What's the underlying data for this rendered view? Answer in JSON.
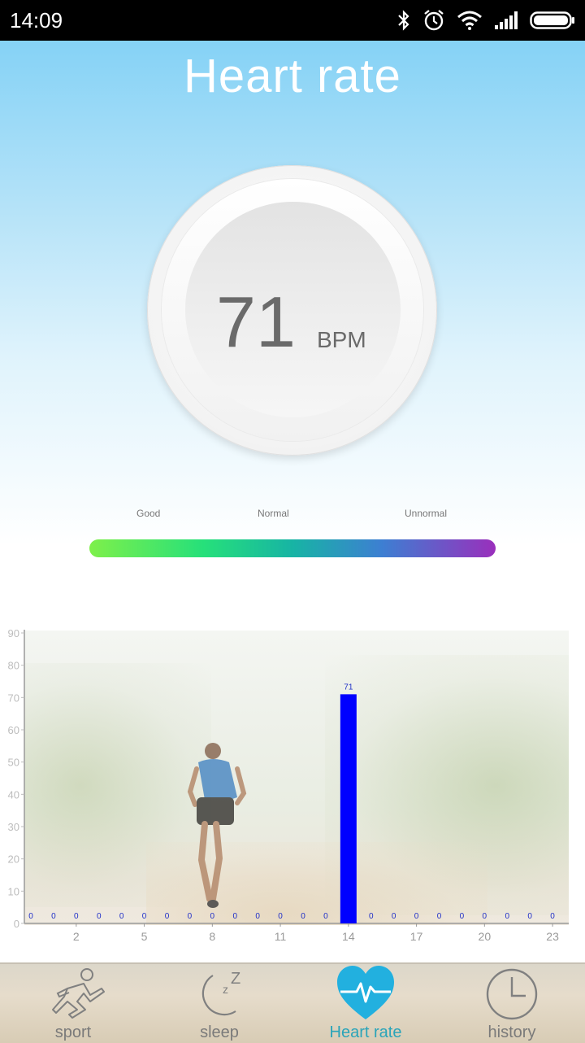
{
  "status_bar": {
    "time": "14:09",
    "icons": [
      "bluetooth-icon",
      "alarm-icon",
      "wifi-icon",
      "signal-icon",
      "battery-icon"
    ]
  },
  "header": {
    "title": "Heart rate"
  },
  "reading": {
    "value": "71",
    "unit": "BPM"
  },
  "scale": {
    "labels": [
      "Good",
      "Normal",
      "Unnormal"
    ],
    "colors": [
      "#7ef04a",
      "#26e07a",
      "#17b4a4",
      "#3d7fd2",
      "#9a2fbc"
    ]
  },
  "chart_data": {
    "type": "bar",
    "x": [
      0,
      1,
      2,
      3,
      4,
      5,
      6,
      7,
      8,
      9,
      10,
      11,
      12,
      13,
      14,
      15,
      16,
      17,
      18,
      19,
      20,
      21,
      22,
      23
    ],
    "values": [
      0,
      0,
      0,
      0,
      0,
      0,
      0,
      0,
      0,
      0,
      0,
      0,
      0,
      0,
      71,
      0,
      0,
      0,
      0,
      0,
      0,
      0,
      0,
      0
    ],
    "value_labels": [
      "0",
      "0",
      "0",
      "0",
      "0",
      "0",
      "0",
      "0",
      "0",
      "0",
      "0",
      "0",
      "0",
      "0",
      "71",
      "0",
      "0",
      "0",
      "0",
      "0",
      "0",
      "0",
      "0",
      "0"
    ],
    "x_tick_labels": [
      "2",
      "5",
      "8",
      "11",
      "14",
      "17",
      "20",
      "23"
    ],
    "x_ticks": [
      2,
      5,
      8,
      11,
      14,
      17,
      20,
      23
    ],
    "y_tick_labels": [
      "0",
      "10",
      "20",
      "30",
      "40",
      "50",
      "60",
      "70",
      "80",
      "90"
    ],
    "ylim": [
      0,
      90
    ],
    "xlim": [
      0,
      24
    ],
    "bar_color": "#0000ff",
    "value_label_color": "#1f2fc8"
  },
  "bottom_nav": {
    "items": [
      {
        "label": "sport",
        "icon": "runner-icon"
      },
      {
        "label": "sleep",
        "icon": "moon-zz-icon"
      },
      {
        "label": "Heart rate",
        "icon": "heart-pulse-icon",
        "active": true
      },
      {
        "label": "history",
        "icon": "clock-icon"
      }
    ],
    "active_color": "#2aa4b9"
  }
}
